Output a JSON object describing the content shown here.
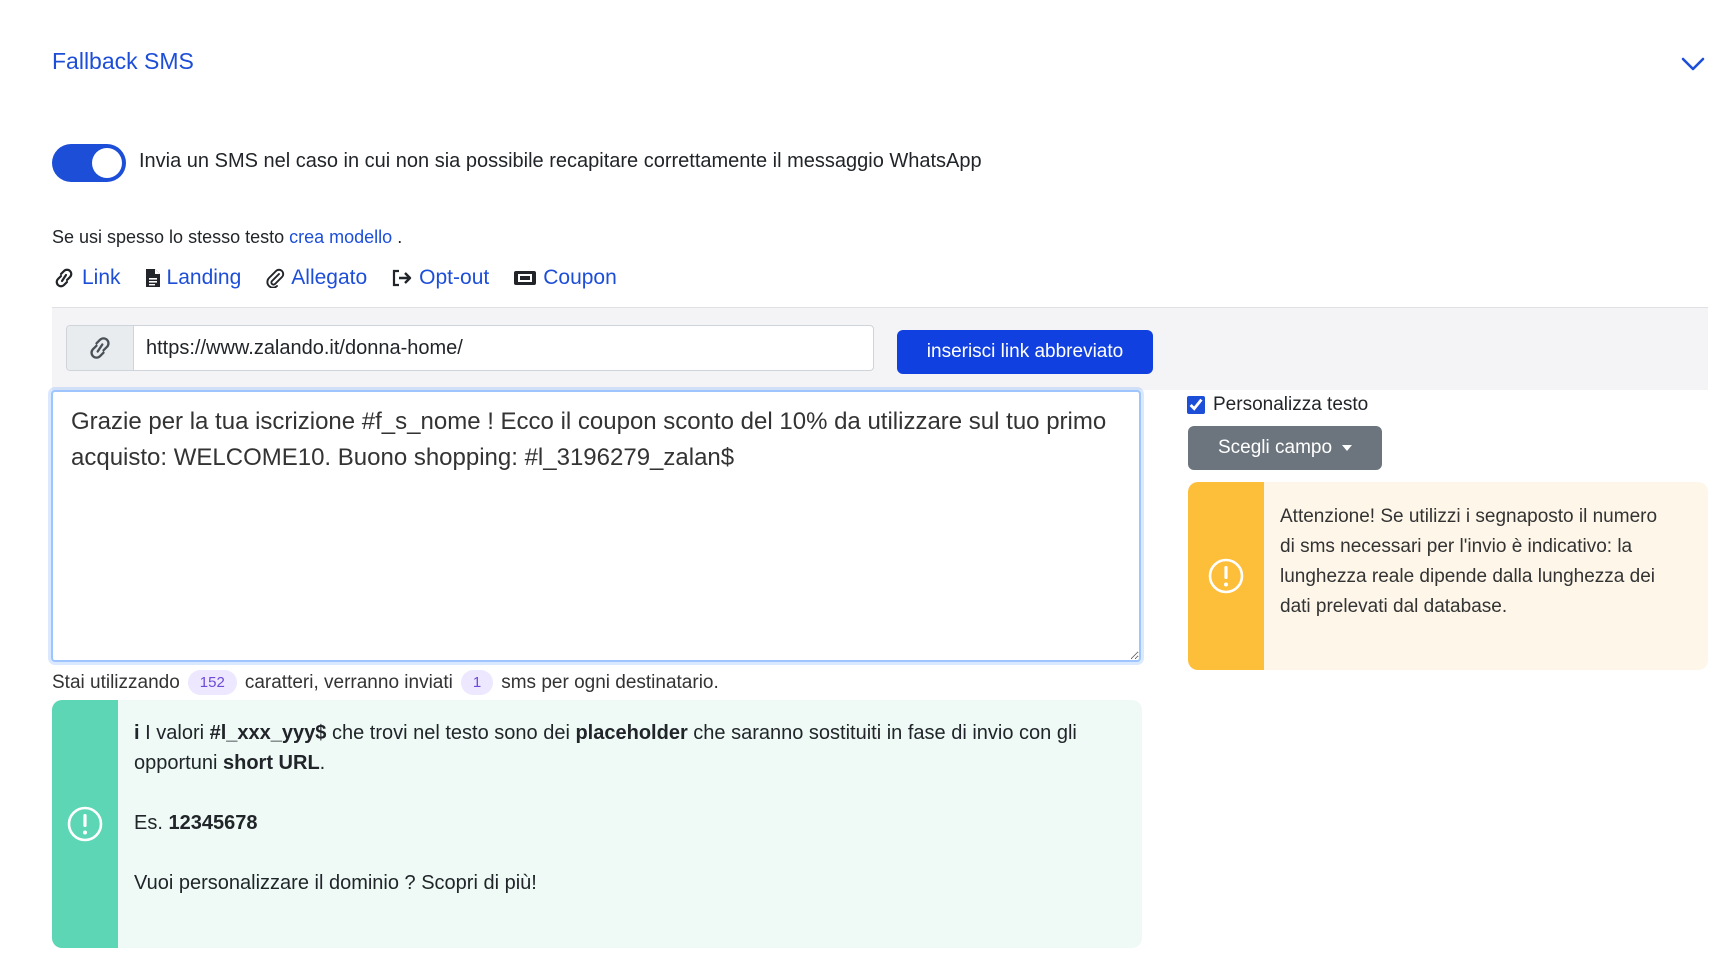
{
  "section": {
    "title": "Fallback SMS",
    "chevron_icon": "chevron-down-icon"
  },
  "toggle": {
    "checked": true,
    "label": "Invia un SMS nel caso in cui non sia possibile recapitare correttamente il messaggio WhatsApp"
  },
  "hint": {
    "prefix": "Se usi spesso lo stesso testo",
    "link": "crea modello",
    "suffix": " ."
  },
  "tools": {
    "link": "Link",
    "landing": "Landing",
    "allegato": "Allegato",
    "optout": "Opt-out",
    "coupon": "Coupon"
  },
  "link_bar": {
    "url_value": "https://www.zalando.it/donna-home/",
    "button_label": "inserisci link abbreviato"
  },
  "message": {
    "text": "Grazie per la tua iscrizione #f_s_nome ! Ecco il coupon sconto del 10% da utilizzare sul tuo primo acquisto: WELCOME10. Buono shopping: #l_3196279_zalan$"
  },
  "counter": {
    "prefix": "Stai utilizzando",
    "chars": "152",
    "middle": "caratteri, verranno inviati",
    "sms": "1",
    "suffix": "sms per ogni destinatario."
  },
  "info": {
    "icon": "i",
    "line1_a": "I valori ",
    "line1_b": "#l_xxx_yyy$",
    "line1_c": " che trovi nel testo sono dei ",
    "line1_d": "placeholder",
    "line1_e": " che saranno sostituiti in fase di invio con gli opportuni ",
    "line1_f": "short URL",
    "line1_g": ".",
    "example_prefix": "Es. ",
    "example_value": "12345678",
    "domain_text": "Vuoi personalizzare il dominio ? Scopri di più!"
  },
  "personalize": {
    "checkbox_label": "Personalizza testo",
    "checked": true,
    "dropdown_label": "Scegli campo"
  },
  "warning": {
    "text": "Attenzione! Se utilizzi i segnaposto il numero di sms necessari per l'invio è indicativo: la lunghezza reale dipende dalla lunghezza dei dati prelevati dal database."
  },
  "colors": {
    "accent": "#1d4ed8",
    "button_primary": "#1140e0",
    "info_stripe": "#5cd6b4",
    "warning_stripe": "#fdbe3a"
  }
}
